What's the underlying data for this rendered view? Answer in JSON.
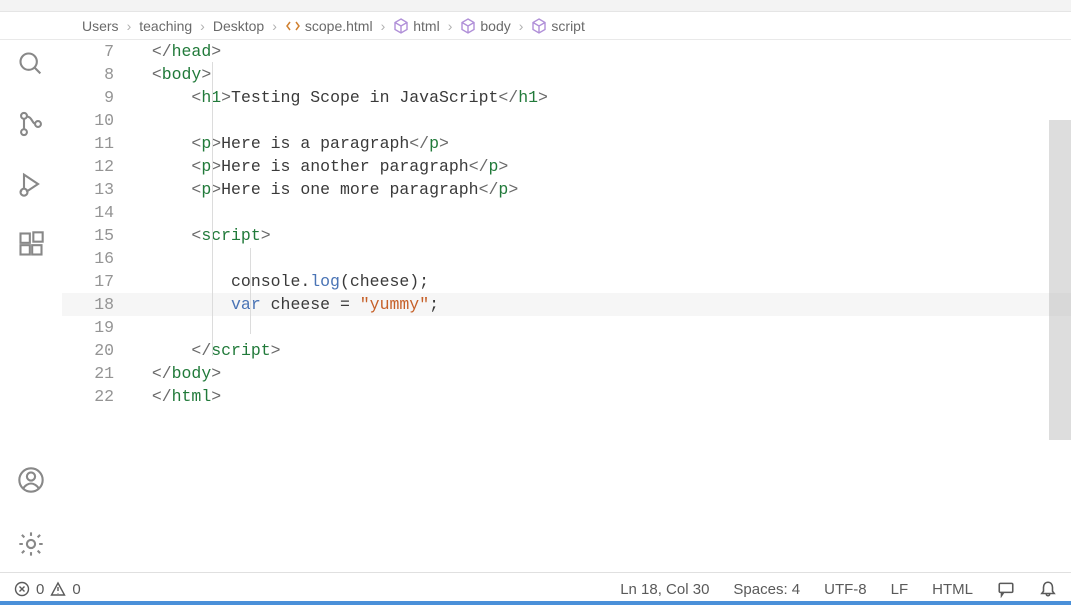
{
  "breadcrumbs": {
    "seg0": "Users",
    "seg1": "teaching",
    "seg2": "Desktop",
    "seg3": "scope.html",
    "seg4": "html",
    "seg5": "body",
    "seg6": "script"
  },
  "lines": {
    "l7": {
      "num": "7"
    },
    "l8": {
      "num": "8"
    },
    "l9": {
      "num": "9"
    },
    "l10": {
      "num": "10"
    },
    "l11": {
      "num": "11"
    },
    "l12": {
      "num": "12"
    },
    "l13": {
      "num": "13"
    },
    "l14": {
      "num": "14"
    },
    "l15": {
      "num": "15"
    },
    "l16": {
      "num": "16"
    },
    "l17": {
      "num": "17"
    },
    "l18": {
      "num": "18"
    },
    "l19": {
      "num": "19"
    },
    "l20": {
      "num": "20"
    },
    "l21": {
      "num": "21"
    },
    "l22": {
      "num": "22"
    }
  },
  "code": {
    "head_close_open": "</",
    "head_tag": "head",
    "close": ">",
    "open": "<",
    "slash_open": "</",
    "body_tag": "body",
    "h1_tag": "h1",
    "h1_text": "Testing Scope in JavaScript",
    "p_tag": "p",
    "p1_text": "Here is a paragraph",
    "p2_text": "Here is another paragraph",
    "p3_text": "Here is one more paragraph",
    "script_tag": "script",
    "console": "console.",
    "log": "log",
    "log_args": "(cheese);",
    "var_kw": "var",
    "var_rest": " cheese = ",
    "str": "\"yummy\"",
    "semi": ";",
    "html_tag": "html"
  },
  "status": {
    "errors": "0",
    "warnings": "0",
    "cursor": "Ln 18, Col 30",
    "spaces": "Spaces: 4",
    "encoding": "UTF-8",
    "eol": "LF",
    "lang": "HTML"
  }
}
